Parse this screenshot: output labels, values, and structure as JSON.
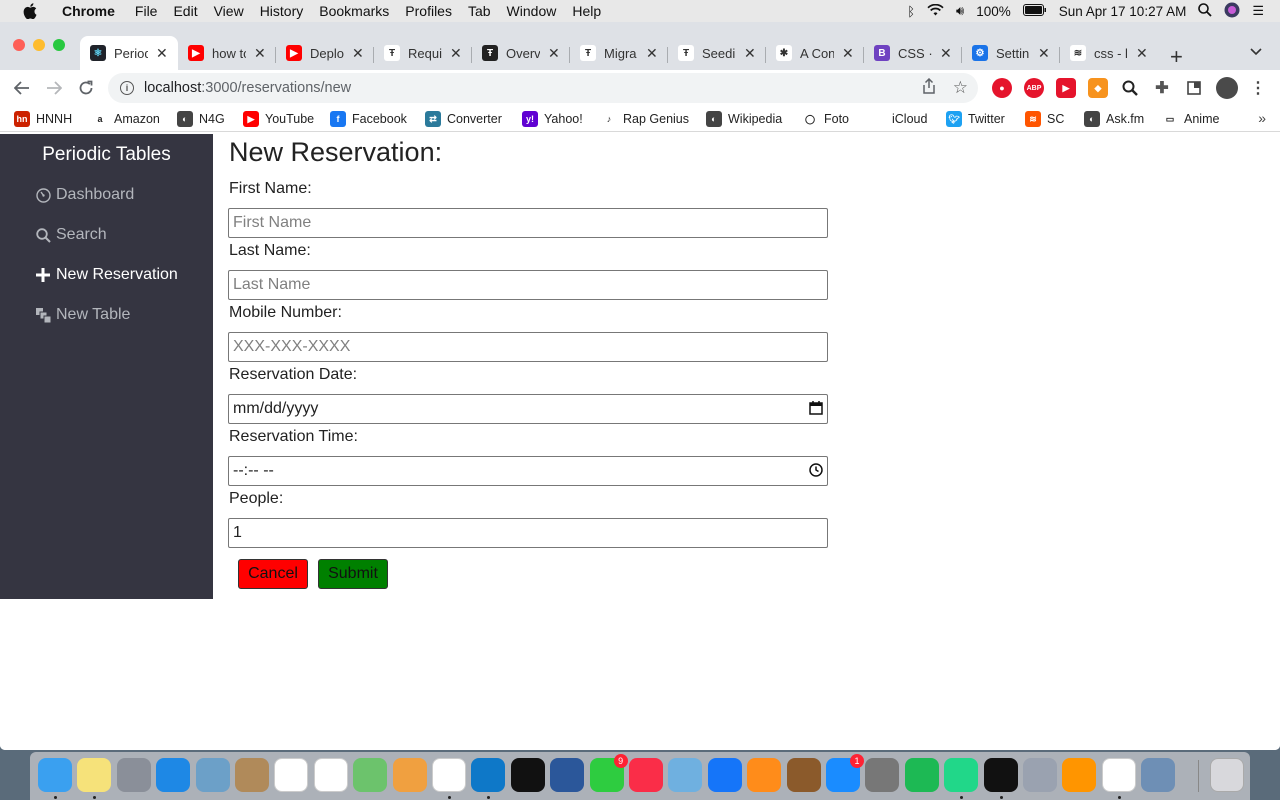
{
  "menubar": {
    "app": "Chrome",
    "items": [
      "File",
      "Edit",
      "View",
      "History",
      "Bookmarks",
      "Profiles",
      "Tab",
      "Window",
      "Help"
    ],
    "battery": "100%",
    "datetime": "Sun Apr 17  10:27 AM"
  },
  "tabs": [
    {
      "title": "Periodic Tables",
      "color": "#20232a",
      "glyph": "⚛",
      "active": true
    },
    {
      "title": "how to",
      "color": "#ff0000",
      "glyph": "▶"
    },
    {
      "title": "Deploy",
      "color": "#ff0000",
      "glyph": "▶"
    },
    {
      "title": "Requi",
      "color": "#ffffff",
      "glyph": "Ŧ"
    },
    {
      "title": "Overv",
      "color": "#222222",
      "glyph": "Ŧ"
    },
    {
      "title": "Migra",
      "color": "#ffffff",
      "glyph": "Ŧ"
    },
    {
      "title": "Seedi",
      "color": "#ffffff",
      "glyph": "Ŧ"
    },
    {
      "title": "A Con",
      "color": "#ffffff",
      "glyph": "✱"
    },
    {
      "title": "CSS ·",
      "color": "#6f42c1",
      "glyph": "B"
    },
    {
      "title": "Settin",
      "color": "#1a73e8",
      "glyph": "⚙"
    },
    {
      "title": "css - l",
      "color": "#ffffff",
      "glyph": "≋"
    }
  ],
  "address": {
    "host": "localhost",
    "path": ":3000/reservations/new"
  },
  "bookmarks": [
    {
      "label": "HNNH",
      "color": "#cc2200"
    },
    {
      "label": "Amazon",
      "color": "#ffffff"
    },
    {
      "label": "N4G",
      "color": "#444444"
    },
    {
      "label": "YouTube",
      "color": "#ff0000"
    },
    {
      "label": "Facebook",
      "color": "#1877f2"
    },
    {
      "label": "Converter",
      "color": "#2b7a9b"
    },
    {
      "label": "Yahoo!",
      "color": "#6001d2"
    },
    {
      "label": "Rap Genius",
      "color": "#ffffff"
    },
    {
      "label": "Wikipedia",
      "color": "#444444"
    },
    {
      "label": "Foto",
      "color": "#ffffff"
    },
    {
      "label": "iCloud",
      "color": "#ffffff"
    },
    {
      "label": "Twitter",
      "color": "#1da1f2"
    },
    {
      "label": "SC",
      "color": "#ff5500"
    },
    {
      "label": "Ask.fm",
      "color": "#444444"
    },
    {
      "label": "Anime",
      "color": "#ffffff"
    }
  ],
  "sidebar": {
    "brand": "Periodic Tables",
    "items": [
      {
        "label": "Dashboard",
        "icon": "dashboard-icon"
      },
      {
        "label": "Search",
        "icon": "search-icon"
      },
      {
        "label": "New Reservation",
        "icon": "plus-icon"
      },
      {
        "label": "New Table",
        "icon": "layers-icon"
      }
    ]
  },
  "form": {
    "title": "New Reservation:",
    "first_name": {
      "label": "First Name:",
      "placeholder": "First Name",
      "value": ""
    },
    "last_name": {
      "label": "Last Name:",
      "placeholder": "Last Name",
      "value": ""
    },
    "mobile": {
      "label": "Mobile Number:",
      "placeholder": "XXX-XXX-XXXX",
      "value": ""
    },
    "date": {
      "label": "Reservation Date:",
      "value": "mm/dd/yyyy"
    },
    "time": {
      "label": "Reservation Time:",
      "value": "--:-- --"
    },
    "people": {
      "label": "People:",
      "value": "1"
    },
    "cancel": "Cancel",
    "submit": "Submit"
  },
  "colors": {
    "sidebar_bg": "#353541",
    "cancel_bg": "#ff0000",
    "submit_bg": "#008000"
  }
}
